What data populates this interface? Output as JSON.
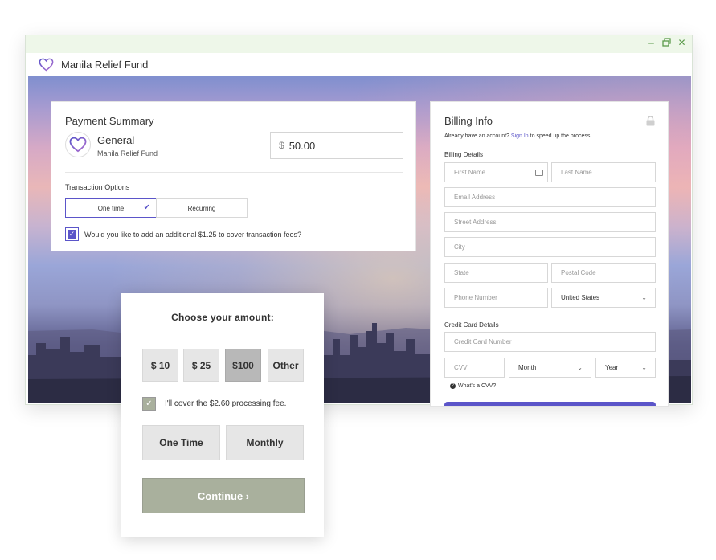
{
  "app": {
    "title": "Manila Relief Fund",
    "window_controls": [
      "minimize-icon",
      "restore-icon",
      "close-icon"
    ],
    "accent_color": "#5b55c9",
    "titlebar_color": "#eef7e9"
  },
  "payment_summary": {
    "title": "Payment Summary",
    "fund_name": "General",
    "fund_org": "Manila Relief Fund",
    "currency_symbol": "$",
    "amount": "50.00",
    "transaction_options_label": "Transaction Options",
    "options": [
      {
        "label": "One time",
        "selected": true
      },
      {
        "label": "Recurring",
        "selected": false
      }
    ],
    "fee_checkbox_checked": true,
    "fee_text": "Would you like to add an additional $1.25 to cover transaction fees?"
  },
  "billing": {
    "title": "Billing Info",
    "account_prompt_before": "Already have an account?",
    "sign_in_link": "Sign In",
    "account_prompt_after": "to speed up the process.",
    "billing_details_label": "Billing Details",
    "first_name_placeholder": "First Name",
    "last_name_placeholder": "Last Name",
    "email_placeholder": "Email Address",
    "street_placeholder": "Street Address",
    "city_placeholder": "City",
    "state_placeholder": "State",
    "postal_placeholder": "Postal Code",
    "phone_placeholder": "Phone Number",
    "country_value": "United States",
    "credit_card_label": "Credit Card Details",
    "card_number_placeholder": "Credit Card Number",
    "cvv_placeholder": "CVV",
    "month_value": "Month",
    "year_value": "Year",
    "cvv_help": "What's a CVV?"
  },
  "widget": {
    "title": "Choose your amount:",
    "amounts": [
      {
        "label": "$ 10",
        "selected": false
      },
      {
        "label": "$ 25",
        "selected": false
      },
      {
        "label": "$100",
        "selected": true
      },
      {
        "label": "Other",
        "selected": false
      }
    ],
    "fee_checked": true,
    "fee_text": "I'll cover the $2.60 processing fee.",
    "frequency": [
      "One Time",
      "Monthly"
    ],
    "continue_label": "Continue ›",
    "button_color": "#a9b09d"
  }
}
